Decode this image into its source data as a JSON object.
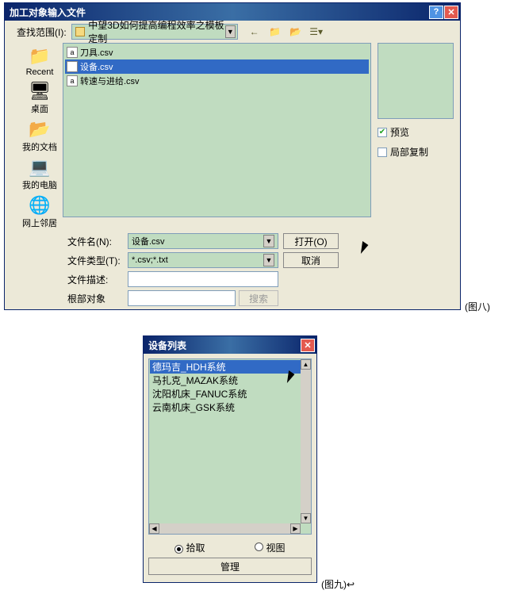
{
  "dialog1": {
    "title": "加工对象输入文件",
    "look_in_label": "查找范围(I):",
    "look_in_value": "中望3D如何提高编程效率之模板定制",
    "nav": [
      {
        "label": "Recent",
        "glyph": "📁"
      },
      {
        "label": "桌面",
        "glyph": "🖥"
      },
      {
        "label": "我的文档",
        "glyph": "📂"
      },
      {
        "label": "我的电脑",
        "glyph": "💻"
      },
      {
        "label": "网上邻居",
        "glyph": "🌐"
      }
    ],
    "files": [
      {
        "name": "刀具.csv",
        "selected": false
      },
      {
        "name": "设备.csv",
        "selected": true
      },
      {
        "name": "转速与进给.csv",
        "selected": false
      }
    ],
    "preview_label": "预览",
    "local_copy_label": "局部复制",
    "filename_label": "文件名(N):",
    "filename_value": "设备.csv",
    "filetype_label": "文件类型(T):",
    "filetype_value": "*.csv;*.txt",
    "filedesc_label": "文件描述:",
    "rootobj_label": "根部对象",
    "open_btn": "打开(O)",
    "cancel_btn": "取消",
    "search_btn": "搜索"
  },
  "dialog2": {
    "title": "设备列表",
    "items": [
      {
        "name": "德玛吉_HDH系统",
        "selected": true
      },
      {
        "name": "马扎克_MAZAK系统",
        "selected": false
      },
      {
        "name": "沈阳机床_FANUC系统",
        "selected": false
      },
      {
        "name": "云南机床_GSK系统",
        "selected": false
      }
    ],
    "radio_pick": "拾取",
    "radio_view": "视图",
    "manage_btn": "管理"
  },
  "captions": {
    "fig8": "(图八)",
    "fig9": "(图九)↩"
  }
}
